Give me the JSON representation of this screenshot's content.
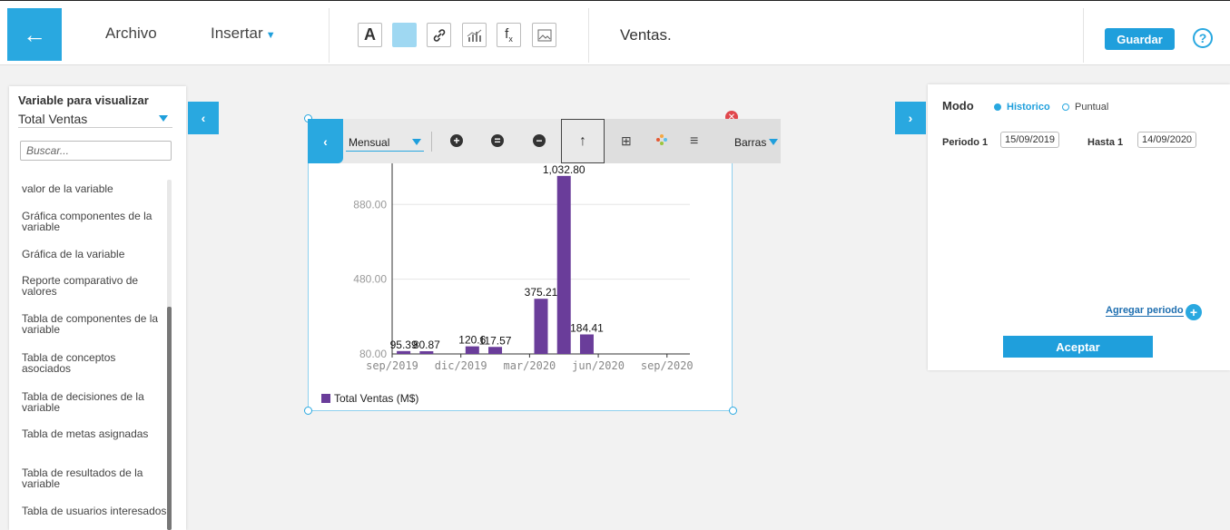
{
  "topbar": {
    "back_icon": "arrow-left-icon",
    "menu": [
      "Archivo",
      "Insertar"
    ],
    "tools": [
      "A",
      "",
      "link",
      "chart",
      "fx",
      "image"
    ],
    "doc_title": "Ventas.",
    "save_label": "Guardar",
    "help_label": "?"
  },
  "left_panel": {
    "title": "Variable para visualizar",
    "selected_variable": "Total Ventas",
    "search_placeholder": "Buscar...",
    "items": [
      "valor de la variable",
      "Gráfica componentes de la variable",
      "Gráfica de la variable",
      "Reporte comparativo de valores",
      "Tabla de componentes de la variable",
      "Tabla de conceptos asociados",
      "Tabla de decisiones de la variable",
      "Tabla de metas asignadas",
      "Tabla de resultados de la variable",
      "Tabla de usuarios interesados"
    ]
  },
  "widget_toolbar": {
    "period": "Mensual",
    "chart_type": "Barras"
  },
  "chart_data": {
    "type": "bar",
    "x_ticks": [
      "sep/2019",
      "dic/2019",
      "mar/2020",
      "jun/2020",
      "sep/2020"
    ],
    "y_ticks": [
      "80.00",
      "480.00",
      "880.00"
    ],
    "ylim": [
      80,
      1100
    ],
    "bars": [
      {
        "label": "95.39",
        "value": 95.39,
        "month": 0.5
      },
      {
        "label": "80.87",
        "value": 80.87,
        "month": 1.5
      },
      {
        "label": "120.6",
        "value": 120.6,
        "month": 3.5
      },
      {
        "label": "117.57",
        "value": 117.57,
        "month": 4.5
      },
      {
        "label": "375.21",
        "value": 375.21,
        "month": 6.5
      },
      {
        "label": "1,032.80",
        "value": 1032.8,
        "month": 7.5
      },
      {
        "label": "184.41",
        "value": 184.41,
        "month": 8.5
      }
    ],
    "series": [
      {
        "name": "Total Ventas (M$)",
        "color": "#6a3d9a"
      }
    ]
  },
  "right_panel": {
    "mode_label": "Modo",
    "mode_options": [
      "Historico",
      "Puntual"
    ],
    "period_label": "Periodo 1",
    "period_start": "15/09/2019",
    "to_label": "Hasta 1",
    "period_end": "14/09/2020",
    "add_period": "Agregar periodo",
    "accept": "Aceptar"
  }
}
